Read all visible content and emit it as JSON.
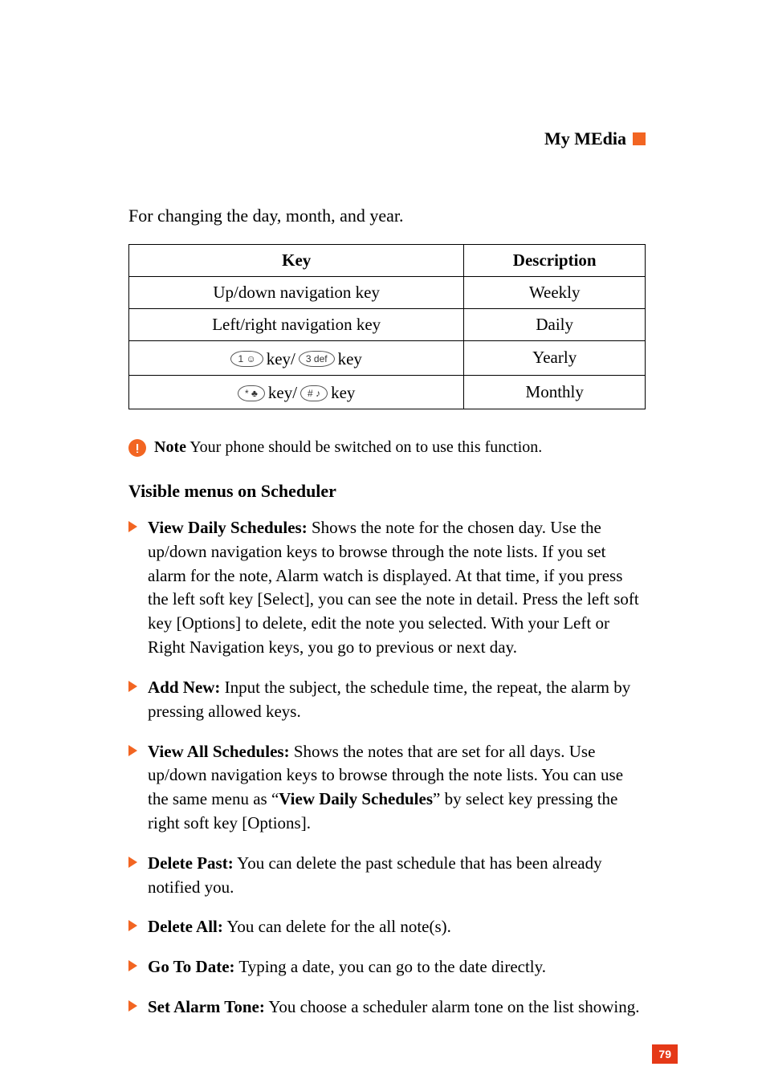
{
  "header": {
    "title": "My MEdia"
  },
  "intro": "For changing the day, month, and year.",
  "table": {
    "headers": {
      "key": "Key",
      "desc": "Description"
    },
    "rows": [
      {
        "key_text": "Up/down navigation key",
        "desc": "Weekly",
        "style": "plain"
      },
      {
        "key_text": "Left/right navigation key",
        "desc": "Daily",
        "style": "plain"
      },
      {
        "left_symbol": "1 ☺",
        "mid1": " key/ ",
        "right_symbol": "3 def",
        "mid2": " key",
        "desc": "Yearly",
        "style": "keys"
      },
      {
        "left_symbol": "* ♣",
        "mid1": " key/ ",
        "right_symbol": "# ♪",
        "mid2": " key",
        "desc": "Monthly",
        "style": "keys"
      }
    ]
  },
  "note": {
    "label": "Note",
    "text": "  Your phone should be switched on to use this function."
  },
  "section_heading": "Visible menus on Scheduler",
  "features": [
    {
      "title": "View Daily Schedules:",
      "body": " Shows the note for the chosen day. Use the up/down navigation keys to browse through the note lists. If you set alarm for the note, Alarm watch is displayed. At that time, if you press the left soft key [Select], you can see the note in detail. Press the left soft key [Options] to delete, edit the note you selected. With your Left or Right Navigation keys, you go to previous or next day."
    },
    {
      "title": "Add New:",
      "body": " Input the subject, the schedule time, the repeat, the alarm by pressing allowed keys."
    },
    {
      "title": "View All Schedules:",
      "body_pre": " Shows the notes that are set for all days. Use up/down navigation keys to browse through the note lists. You can use the same menu as “",
      "body_bold": "View Daily Schedules",
      "body_post": "” by select key pressing the right soft key [Options]."
    },
    {
      "title": "Delete Past:",
      "body": " You can delete the past schedule that has been already notified you."
    },
    {
      "title": "Delete All:",
      "body": " You can delete for the all note(s)."
    },
    {
      "title": "Go To Date:",
      "body": " Typing a date, you can go to the date directly."
    },
    {
      "title": "Set Alarm Tone:",
      "body": " You choose a scheduler alarm tone on the list showing."
    }
  ],
  "page_number": "79"
}
